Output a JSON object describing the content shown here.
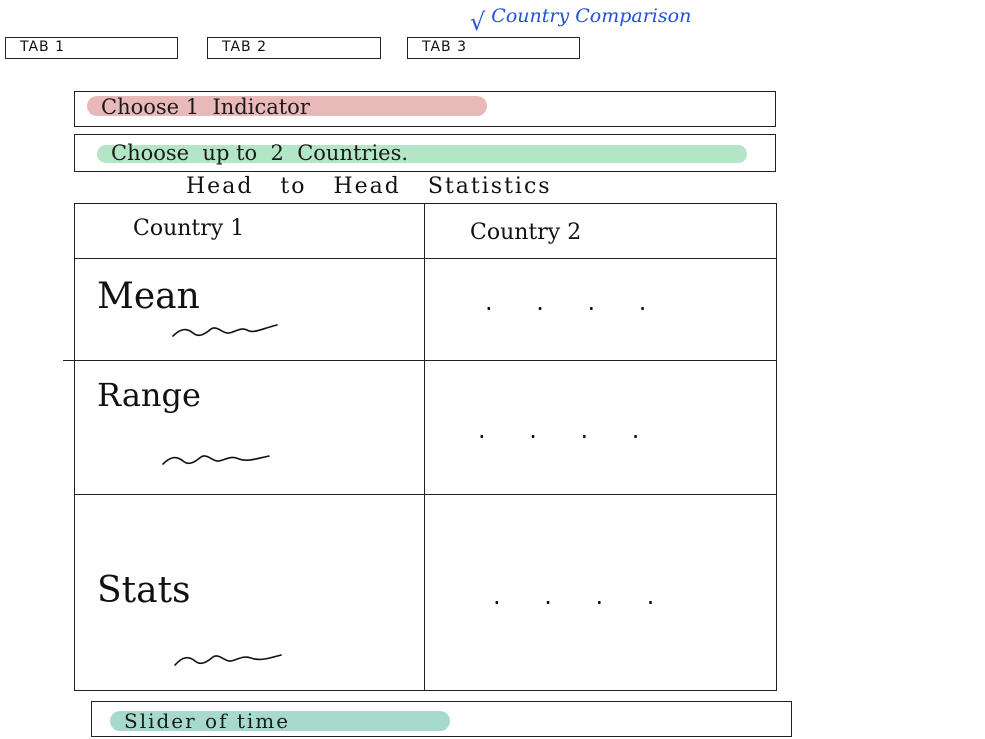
{
  "tabs": [
    {
      "label": "TAB 1"
    },
    {
      "label": "TAB 2"
    },
    {
      "label": "TAB 3"
    }
  ],
  "annotation": {
    "text": "Country Comparison"
  },
  "indicator_select": {
    "label": "Choose 1  Indicator"
  },
  "countries_select": {
    "label": "Choose  up to  2  Countries."
  },
  "heading": "Head to Head Statistics",
  "table": {
    "columns": [
      "Country 1",
      "Country 2"
    ],
    "rows": [
      {
        "label": "Mean",
        "value": ". . . ."
      },
      {
        "label": "Range",
        "value": ". . . ."
      },
      {
        "label": "Stats",
        "value": ". . . ."
      }
    ]
  },
  "slider": {
    "label": "Slider of time"
  },
  "colors": {
    "indicator_highlight": "#e8b9b9",
    "countries_highlight": "#b3e6c6",
    "slider_highlight": "#a7d9cd",
    "annotation_ink": "#2450d8"
  }
}
